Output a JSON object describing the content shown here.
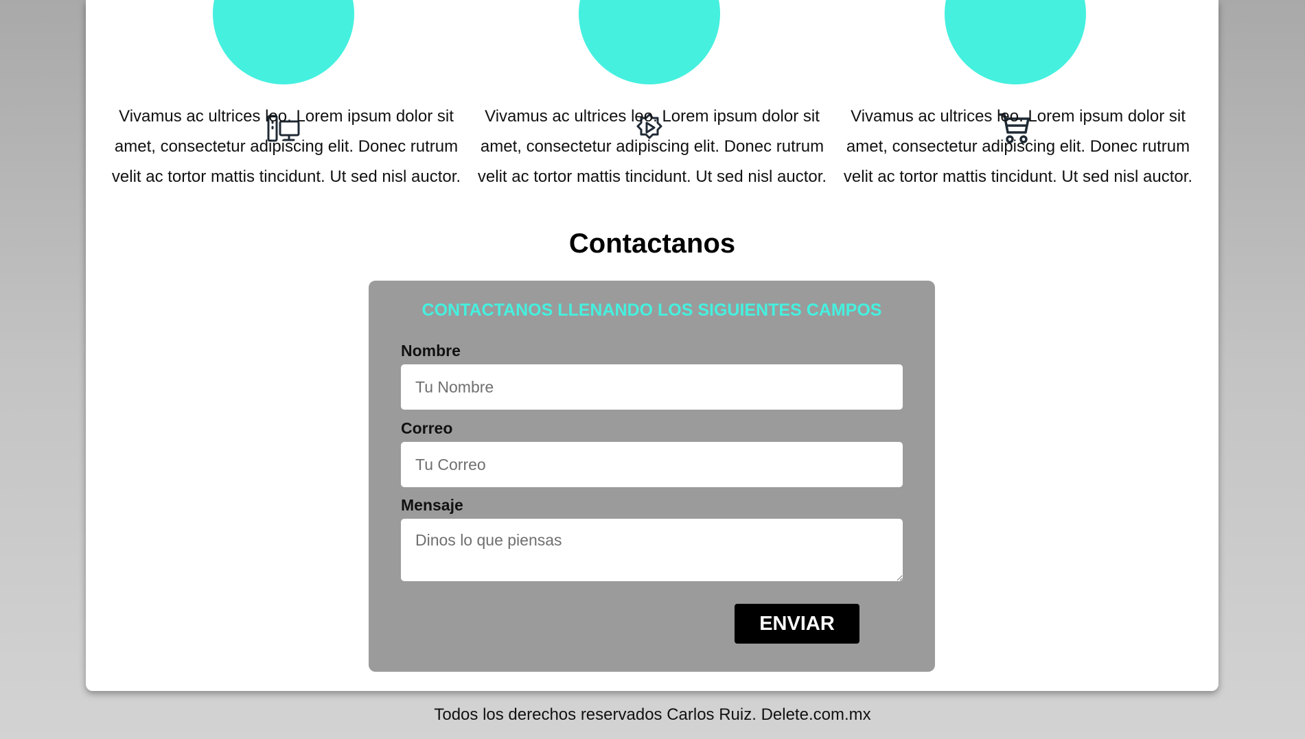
{
  "services": [
    {
      "icon": "devices-icon",
      "text": "Vivamus ac ultrices leo. Lorem ipsum dolor sit amet, consectetur adipiscing elit. Donec rutrum velit ac tortor mattis tincidunt. Ut sed nisl auctor."
    },
    {
      "icon": "gear-play-icon",
      "text": "Vivamus ac ultrices leo. Lorem ipsum dolor sit amet, consectetur adipiscing elit. Donec rutrum velit ac tortor mattis tincidunt. Ut sed nisl auctor."
    },
    {
      "icon": "shopping-cart-icon",
      "text": "Vivamus ac ultrices leo. Lorem ipsum dolor sit amet, consectetur adipiscing elit. Donec rutrum velit ac tortor mattis tincidunt. Ut sed nisl auctor."
    }
  ],
  "contact": {
    "title": "Contactanos",
    "form_heading": "CONTACTANOS LLENANDO LOS SIGUIENTES CAMPOS",
    "name_label": "Nombre",
    "name_placeholder": "Tu Nombre",
    "email_label": "Correo",
    "email_placeholder": "Tu Correo",
    "message_label": "Mensaje",
    "message_placeholder": "Dinos lo que piensas",
    "submit_label": "ENVIAR"
  },
  "footer": {
    "text": "Todos los derechos reservados Carlos Ruiz. Delete.com.mx"
  },
  "colors": {
    "accent": "#45f0df",
    "form_background": "#9b9b9b",
    "button": "#000000"
  }
}
